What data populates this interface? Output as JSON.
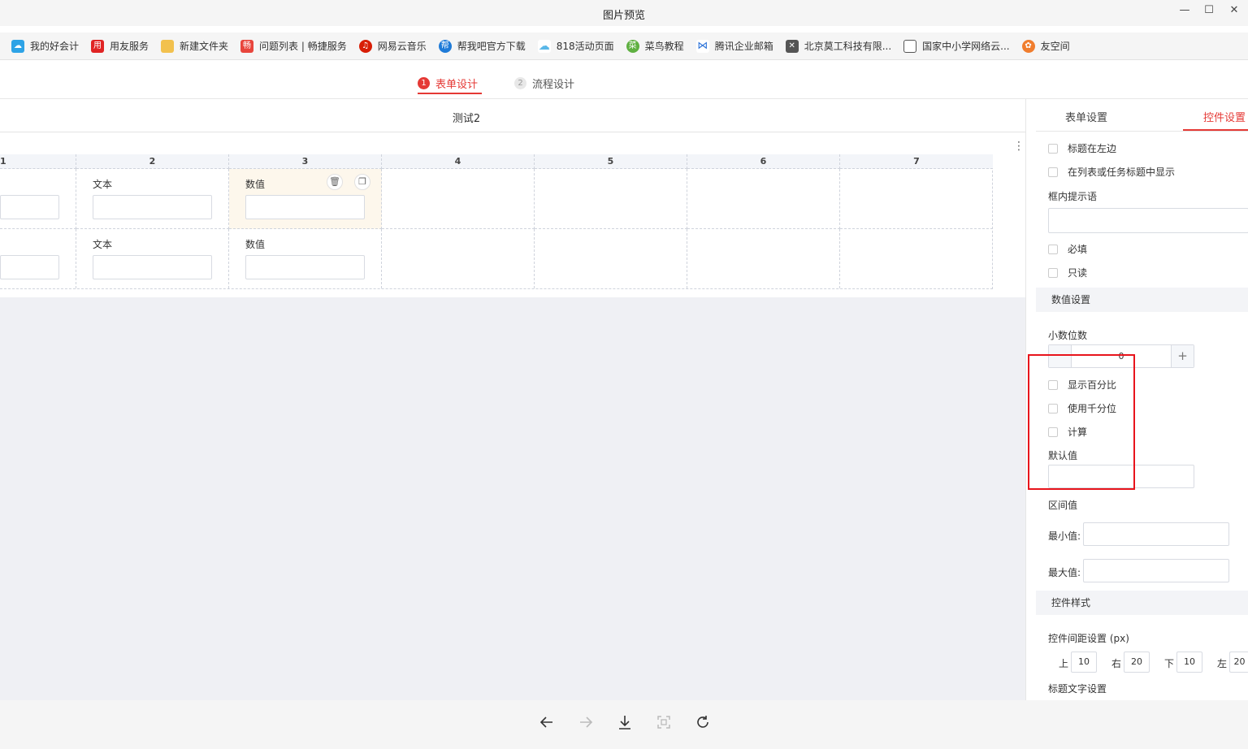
{
  "window": {
    "title": "图片预览"
  },
  "bookmarks": [
    {
      "label": "我的好会计",
      "icon": "cloud-ledger-icon",
      "color": "#2ea3e6"
    },
    {
      "label": "用友服务",
      "icon": "yonyou-icon",
      "color": "#e02424"
    },
    {
      "label": "新建文件夹",
      "icon": "folder-icon",
      "color": "#f2c14e"
    },
    {
      "label": "问题列表 | 畅捷服务",
      "icon": "chanjet-icon",
      "color": "#e8453c"
    },
    {
      "label": "网易云音乐",
      "icon": "netease-music-icon",
      "color": "#d81e06"
    },
    {
      "label": "帮我吧官方下载",
      "icon": "bangwoba-icon",
      "color": "#1f7bd8"
    },
    {
      "label": "818活动页面",
      "icon": "cloud-icon",
      "color": "#59b7e8"
    },
    {
      "label": "菜鸟教程",
      "icon": "runoob-icon",
      "color": "#5fb041"
    },
    {
      "label": "腾讯企业邮箱",
      "icon": "tencent-mail-icon",
      "color": "#2b72d8"
    },
    {
      "label": "北京莫工科技有限...",
      "icon": "tools-icon",
      "color": "#555555"
    },
    {
      "label": "国家中小学网络云...",
      "icon": "page-icon",
      "color": "#555555"
    },
    {
      "label": "友空间",
      "icon": "youkongjian-icon",
      "color": "#f07d2e"
    }
  ],
  "steps": [
    {
      "num": "1",
      "label": "表单设计",
      "active": true
    },
    {
      "num": "2",
      "label": "流程设计",
      "active": false
    }
  ],
  "form": {
    "title": "测试2",
    "columns": [
      "1",
      "2",
      "3",
      "4",
      "5",
      "6",
      "7"
    ],
    "rows": [
      {
        "cells": [
          "",
          "文本",
          "数值",
          "",
          "",
          "",
          ""
        ]
      },
      {
        "cells": [
          "",
          "文本",
          "数值",
          "",
          "",
          "",
          ""
        ]
      }
    ]
  },
  "panel": {
    "tabs": [
      "表单设置",
      "控件设置"
    ],
    "active_tab": "控件设置",
    "checkbox_title_left": "标题在左边",
    "checkbox_show_in_list": "在列表或任务标题中显示",
    "placeholder_label": "框内提示语",
    "checkbox_required": "必填",
    "checkbox_readonly": "只读",
    "section_number": "数值设置",
    "decimal_label": "小数位数",
    "decimal_value": "0",
    "checkbox_percent": "显示百分比",
    "checkbox_thousands": "使用千分位",
    "checkbox_calc": "计算",
    "default_label": "默认值",
    "range_label": "区间值",
    "min_label": "最小值:",
    "max_label": "最大值:",
    "section_style": "控件样式",
    "spacing_label": "控件间距设置 (px)",
    "spacing": [
      {
        "label": "上",
        "value": "10"
      },
      {
        "label": "右",
        "value": "20"
      },
      {
        "label": "下",
        "value": "10"
      },
      {
        "label": "左",
        "value": "20"
      }
    ],
    "title_text_label": "标题文字设置"
  },
  "accent_color": "#e53935",
  "highlight_color": "#e8141c"
}
